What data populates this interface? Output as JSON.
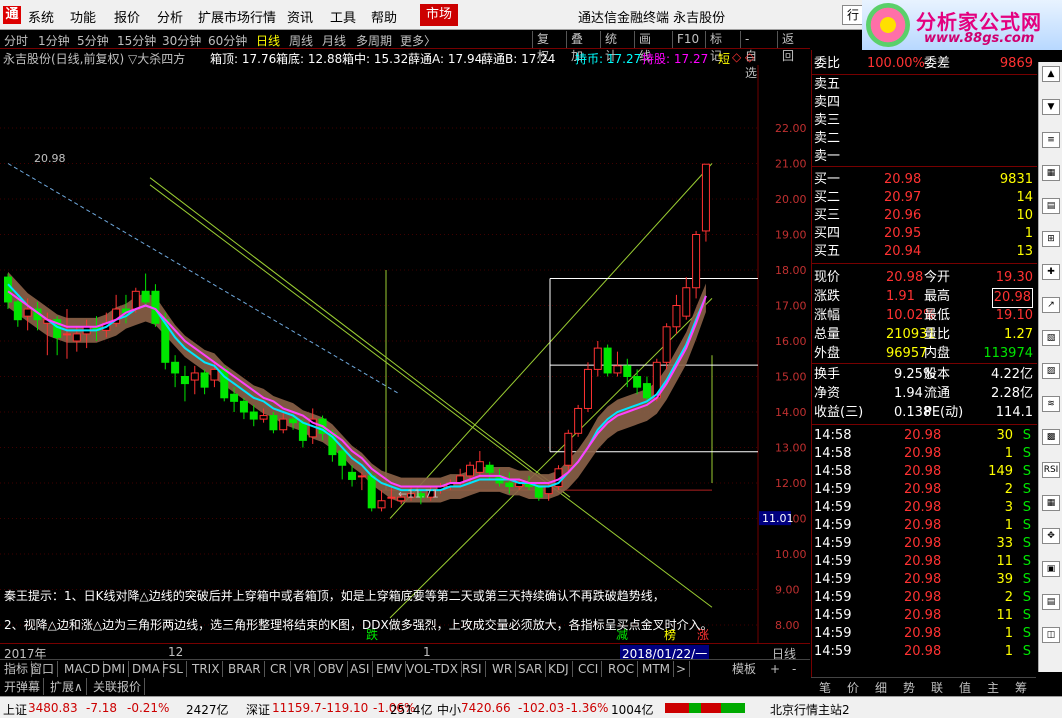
{
  "menu": {
    "items": [
      "系统",
      "功能",
      "报价",
      "分析",
      "扩展市场行情",
      "资讯",
      "工具",
      "帮助"
    ],
    "market_label": "市场",
    "app_title": "通达信金融终端",
    "stock_name": "永吉股份",
    "right_button": "行"
  },
  "brand": {
    "name": "分析家公式网",
    "url": "www.88gs.com"
  },
  "periods": {
    "items": [
      "分时",
      "1分钟",
      "5分钟",
      "15分钟",
      "30分钟",
      "60分钟",
      "日线",
      "周线",
      "月线",
      "多周期",
      "更多〉"
    ],
    "active": "日线",
    "right_buttons": [
      "复权",
      "叠加",
      "统计",
      "画线",
      "F10",
      "标记",
      "-自选",
      "返回"
    ]
  },
  "infobar": {
    "title": "永吉股份(日线,前复权) ▽大杀四方",
    "box_top": "箱顶: 17.76",
    "box_bottom": "箱底: 12.88",
    "box_mid": "箱中: 15.32",
    "xue_a": "薛通A: 17.94",
    "xue_b": "薛通B: 17.24",
    "hold_coin": "持币: 17.27",
    "hold_stock": "持股: 17.27",
    "short": "短",
    "diamonds": "◇ ◇"
  },
  "chart_data": {
    "type": "candlestick",
    "ylim": [
      8.0,
      22.5
    ],
    "yticks": [
      "22.00",
      "21.00",
      "20.00",
      "19.00",
      "18.00",
      "17.00",
      "16.00",
      "15.00",
      "14.00",
      "13.00",
      "12.00",
      "11.00",
      "10.00",
      "9.00",
      "8.00"
    ],
    "price_tag": "11.01",
    "labels": {
      "high": "20.98",
      "low": "11.71"
    },
    "markers": {
      "die": "跌",
      "jian": "减",
      "bang": "榜",
      "zhang": "涨"
    },
    "tips": [
      "秦王提示：1、日K线对降△边线的突破后并上穿箱中或者箱顶，如是上穿箱底要等第二天或第三天持续确认不再跌破趋势线，",
      "2、视降△边和涨△边为三角形两边线，选三角形整理将结束的K图，DDX做多强烈，上攻成交量必须放大，各指标呈买点金叉时介入。"
    ],
    "x_labels": {
      "start": "2017年",
      "month": "12",
      "jan": "1",
      "date": "2018/01/22/一",
      "period": "日线"
    },
    "candles": [
      [
        17.8,
        17.1,
        17.9,
        16.9
      ],
      [
        17.1,
        16.6,
        17.3,
        16.4
      ],
      [
        16.7,
        16.9,
        17.2,
        16.3
      ],
      [
        16.9,
        16.6,
        17.1,
        16.3
      ],
      [
        16.5,
        16.6,
        16.8,
        15.6
      ],
      [
        16.6,
        16.1,
        16.7,
        15.6
      ],
      [
        16.2,
        16.2,
        16.9,
        15.5
      ],
      [
        16.0,
        16.2,
        16.4,
        15.7
      ],
      [
        16.2,
        16.4,
        16.6,
        15.8
      ],
      [
        16.4,
        16.3,
        16.7,
        16.0
      ],
      [
        16.3,
        16.5,
        16.8,
        16.1
      ],
      [
        16.5,
        16.9,
        17.3,
        16.4
      ],
      [
        16.9,
        16.8,
        17.3,
        16.5
      ],
      [
        16.9,
        17.4,
        17.5,
        16.8
      ],
      [
        17.4,
        17.1,
        17.9,
        17.0
      ],
      [
        17.4,
        16.5,
        17.6,
        16.4
      ],
      [
        16.6,
        15.4,
        16.8,
        15.2
      ],
      [
        15.4,
        15.1,
        15.6,
        14.7
      ],
      [
        15.0,
        14.8,
        15.3,
        14.3
      ],
      [
        14.9,
        15.1,
        15.3,
        14.5
      ],
      [
        15.1,
        14.7,
        15.2,
        14.5
      ],
      [
        14.9,
        15.2,
        15.4,
        14.7
      ],
      [
        15.2,
        14.4,
        15.3,
        14.3
      ],
      [
        14.5,
        14.3,
        14.7,
        14.0
      ],
      [
        14.3,
        14.0,
        14.4,
        13.8
      ],
      [
        14.0,
        13.8,
        14.2,
        13.6
      ],
      [
        13.8,
        13.9,
        14.1,
        13.7
      ],
      [
        13.9,
        13.5,
        14.0,
        13.4
      ],
      [
        13.5,
        13.8,
        14.0,
        13.4
      ],
      [
        13.8,
        13.7,
        14.0,
        13.5
      ],
      [
        13.7,
        13.2,
        13.8,
        13.0
      ],
      [
        13.3,
        13.8,
        14.1,
        13.1
      ],
      [
        13.8,
        13.4,
        13.9,
        13.2
      ],
      [
        13.4,
        12.8,
        13.5,
        12.6
      ],
      [
        12.9,
        12.5,
        13.0,
        12.1
      ],
      [
        12.3,
        12.1,
        12.5,
        11.9
      ],
      [
        12.2,
        12.2,
        12.3,
        11.8
      ],
      [
        12.2,
        11.3,
        12.3,
        11.2
      ],
      [
        11.3,
        11.5,
        11.8,
        11.2
      ],
      [
        11.6,
        11.6,
        11.9,
        11.3
      ],
      [
        11.5,
        11.6,
        11.7,
        11.4
      ],
      [
        11.6,
        11.7,
        11.9,
        11.5
      ],
      [
        11.7,
        11.6,
        11.8,
        11.4
      ],
      [
        11.6,
        11.8,
        11.9,
        11.5
      ],
      [
        11.8,
        11.9,
        12.0,
        11.7
      ],
      [
        11.9,
        12.0,
        12.1,
        11.8
      ],
      [
        12.0,
        12.2,
        12.4,
        11.9
      ],
      [
        12.2,
        12.5,
        12.6,
        12.0
      ],
      [
        12.3,
        12.6,
        12.9,
        12.2
      ],
      [
        12.5,
        12.3,
        12.6,
        12.1
      ],
      [
        12.2,
        12.0,
        12.4,
        11.9
      ],
      [
        12.0,
        11.9,
        12.3,
        11.7
      ],
      [
        11.9,
        12.0,
        12.1,
        11.8
      ],
      [
        12.0,
        11.9,
        12.2,
        11.8
      ],
      [
        11.9,
        11.6,
        12.0,
        11.5
      ],
      [
        11.7,
        11.9,
        12.0,
        11.5
      ],
      [
        11.9,
        12.4,
        12.5,
        11.8
      ],
      [
        12.5,
        13.4,
        13.5,
        12.3
      ],
      [
        13.4,
        14.1,
        14.2,
        13.3
      ],
      [
        14.1,
        15.2,
        15.4,
        14.0
      ],
      [
        15.2,
        15.8,
        16.0,
        15.0
      ],
      [
        15.8,
        15.1,
        15.9,
        15.0
      ],
      [
        15.1,
        15.3,
        15.7,
        15.0
      ],
      [
        15.3,
        15.0,
        15.5,
        14.7
      ],
      [
        15.0,
        14.7,
        15.2,
        14.5
      ],
      [
        14.8,
        14.4,
        15.0,
        14.2
      ],
      [
        14.4,
        15.4,
        15.5,
        14.3
      ],
      [
        15.4,
        16.4,
        16.5,
        15.2
      ],
      [
        16.4,
        17.0,
        17.3,
        16.2
      ],
      [
        16.7,
        17.5,
        17.8,
        16.6
      ],
      [
        17.5,
        19.0,
        19.1,
        17.2
      ],
      [
        19.1,
        20.98,
        20.98,
        18.8
      ]
    ],
    "series": [
      {
        "name": "持币",
        "values": [
          17.6,
          17.3,
          17.0,
          16.8,
          16.6,
          16.4,
          16.3,
          16.3,
          16.3,
          16.3,
          16.4,
          16.6,
          16.7,
          16.9,
          17.0,
          16.9,
          16.5,
          16.1,
          15.8,
          15.6,
          15.4,
          15.3,
          15.0,
          14.8,
          14.6,
          14.4,
          14.3,
          14.1,
          14.0,
          13.9,
          13.7,
          13.6,
          13.5,
          13.3,
          13.0,
          12.7,
          12.5,
          12.2,
          12.0,
          11.9,
          11.8,
          11.8,
          11.8,
          11.8,
          11.8,
          11.9,
          11.9,
          12.0,
          12.1,
          12.1,
          12.1,
          12.1,
          12.0,
          12.0,
          11.9,
          11.9,
          12.0,
          12.3,
          12.6,
          13.0,
          13.5,
          13.8,
          14.0,
          14.1,
          14.2,
          14.3,
          14.5,
          14.9,
          15.4,
          15.9,
          16.6,
          17.27
        ]
      },
      {
        "name": "持股",
        "values": [
          17.4,
          17.2,
          17.0,
          16.8,
          16.6,
          16.5,
          16.4,
          16.4,
          16.4,
          16.4,
          16.5,
          16.6,
          16.8,
          16.9,
          17.0,
          16.9,
          16.6,
          16.3,
          16.0,
          15.8,
          15.6,
          15.4,
          15.2,
          15.0,
          14.8,
          14.6,
          14.4,
          14.3,
          14.1,
          14.0,
          13.9,
          13.7,
          13.6,
          13.4,
          13.2,
          12.9,
          12.7,
          12.4,
          12.2,
          12.0,
          11.9,
          11.9,
          11.9,
          11.9,
          11.9,
          12.0,
          12.0,
          12.1,
          12.2,
          12.2,
          12.2,
          12.1,
          12.1,
          12.0,
          12.0,
          12.0,
          12.1,
          12.3,
          12.6,
          13.0,
          13.4,
          13.7,
          13.9,
          14.0,
          14.1,
          14.2,
          14.4,
          14.8,
          15.3,
          15.8,
          16.5,
          17.27
        ]
      }
    ]
  },
  "bottom_tabs": {
    "indicators": [
      "指标",
      "窗口",
      "MACD",
      "DMI",
      "DMA",
      "FSL",
      "TRIX",
      "BRAR",
      "CR",
      "VR",
      "OBV",
      "ASI",
      "EMV",
      "VOL-TDX",
      "RSI",
      "WR",
      "SAR",
      "KDJ",
      "CCI",
      "ROC",
      "MTM",
      ">"
    ],
    "template": "模板",
    "plus": "+",
    "minus": "-",
    "row2": [
      "开弹幕",
      "扩展∧",
      "关联报价"
    ]
  },
  "status": {
    "sh_label": "上证",
    "sh_value": "3480.83",
    "sh_change": "-7.18",
    "sh_pct": "-0.21%",
    "sh_amount": "2427亿",
    "sz_label": "深证",
    "sz_value": "11159.7",
    "sz_change": "-119.10",
    "sz_pct": "-1.06%",
    "sz_amount": "2514亿",
    "zx_label": "中小",
    "zx_value": "7420.66",
    "zx_change": "-102.03",
    "zx_pct": "-1.36%",
    "zx_amount": "1004亿",
    "server": "北京行情主站2"
  },
  "quote": {
    "wei_bi_label": "委比",
    "wei_bi": "100.00%",
    "wei_cha_label": "委差",
    "wei_cha": "9869",
    "sell": [
      {
        "label": "卖五"
      },
      {
        "label": "卖四"
      },
      {
        "label": "卖三"
      },
      {
        "label": "卖二"
      },
      {
        "label": "卖一"
      }
    ],
    "buy": [
      {
        "label": "买一",
        "price": "20.98",
        "vol": "9831"
      },
      {
        "label": "买二",
        "price": "20.97",
        "vol": "14"
      },
      {
        "label": "买三",
        "price": "20.96",
        "vol": "10"
      },
      {
        "label": "买四",
        "price": "20.95",
        "vol": "1"
      },
      {
        "label": "买五",
        "price": "20.94",
        "vol": "13"
      }
    ],
    "stats": [
      [
        "现价",
        "20.98",
        "今开",
        "19.30"
      ],
      [
        "涨跌",
        "1.91",
        "最高",
        "20.98"
      ],
      [
        "涨幅",
        "10.02%",
        "最低",
        "19.10"
      ],
      [
        "总量",
        "210931",
        "量比",
        "1.27"
      ],
      [
        "外盘",
        "96957",
        "内盘",
        "113974"
      ]
    ],
    "stats2": [
      [
        "换手",
        "9.25%",
        "股本",
        "4.22亿"
      ],
      [
        "净资",
        "1.94",
        "流通",
        "2.28亿"
      ],
      [
        "收益(三)",
        "0.138",
        "PE(动)",
        "114.1"
      ]
    ],
    "ticks": [
      [
        "14:58",
        "20.98",
        "30",
        "S"
      ],
      [
        "14:58",
        "20.98",
        "1",
        "S"
      ],
      [
        "14:58",
        "20.98",
        "149",
        "S"
      ],
      [
        "14:59",
        "20.98",
        "2",
        "S"
      ],
      [
        "14:59",
        "20.98",
        "3",
        "S"
      ],
      [
        "14:59",
        "20.98",
        "1",
        "S"
      ],
      [
        "14:59",
        "20.98",
        "33",
        "S"
      ],
      [
        "14:59",
        "20.98",
        "11",
        "S"
      ],
      [
        "14:59",
        "20.98",
        "39",
        "S"
      ],
      [
        "14:59",
        "20.98",
        "2",
        "S"
      ],
      [
        "14:59",
        "20.98",
        "11",
        "S"
      ],
      [
        "14:59",
        "20.98",
        "1",
        "S"
      ],
      [
        "14:59",
        "20.98",
        "1",
        "S"
      ]
    ],
    "tabs": [
      "笔",
      "价",
      "细",
      "势",
      "联",
      "值",
      "主",
      "筹"
    ]
  },
  "sidetools": [
    "▲",
    "▼",
    "≡",
    "▦",
    "▤",
    "⊞",
    "✚",
    "↗",
    "▧",
    "▨",
    "≋",
    "▩",
    "RSI",
    "▦",
    "✥",
    "▣",
    "▤",
    "◫"
  ]
}
